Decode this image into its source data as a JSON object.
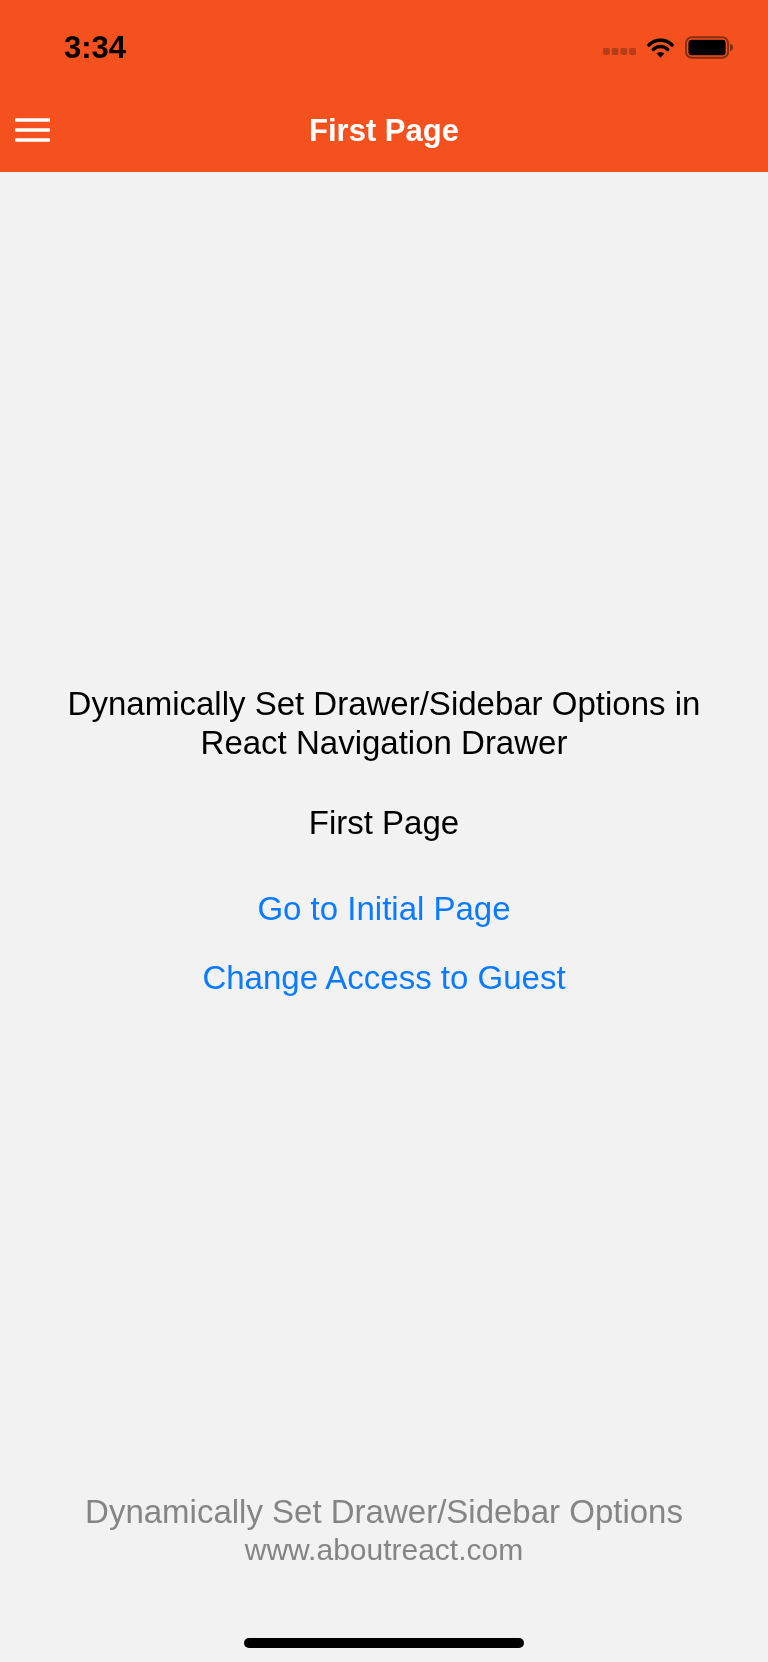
{
  "status_bar": {
    "time": "3:34"
  },
  "header": {
    "title": "First Page"
  },
  "content": {
    "heading": "Dynamically Set Drawer/Sidebar Options in React Navigation Drawer",
    "page_label": "First Page",
    "buttons": [
      "Go to Initial Page",
      "Change Access to Guest"
    ]
  },
  "footer": {
    "title": "Dynamically Set Drawer/Sidebar Options",
    "url": "www.aboutreact.com"
  }
}
